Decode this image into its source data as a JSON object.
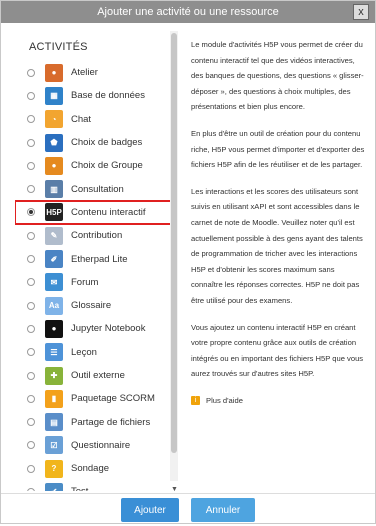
{
  "dialog": {
    "title": "Ajouter une activité ou une ressource",
    "close_label": "x"
  },
  "left": {
    "section_title": "ACTIVITÉS",
    "items": [
      {
        "label": "Atelier",
        "icon": "workshop-icon",
        "color": "#d86b2c",
        "glyph": "●"
      },
      {
        "label": "Base de données",
        "icon": "database-icon",
        "color": "#2f82c9",
        "glyph": "▦"
      },
      {
        "label": "Chat",
        "icon": "chat-icon",
        "color": "#f2a530",
        "glyph": "◔"
      },
      {
        "label": "Choix de badges",
        "icon": "badge-icon",
        "color": "#2b6fbf",
        "glyph": "⬟"
      },
      {
        "label": "Choix de Groupe",
        "icon": "group-choice-icon",
        "color": "#e58a1f",
        "glyph": "●"
      },
      {
        "label": "Consultation",
        "icon": "survey-icon",
        "color": "#5a7ea8",
        "glyph": "▥"
      },
      {
        "label": "Contenu interactif",
        "icon": "h5p-icon",
        "color": "#222222",
        "glyph": "H5P",
        "selected": true
      },
      {
        "label": "Contribution",
        "icon": "assignment-icon",
        "color": "#b0bccc",
        "glyph": "✎"
      },
      {
        "label": "Etherpad Lite",
        "icon": "etherpad-icon",
        "color": "#4a84c4",
        "glyph": "✐"
      },
      {
        "label": "Forum",
        "icon": "forum-icon",
        "color": "#3d8fd3",
        "glyph": "✉"
      },
      {
        "label": "Glossaire",
        "icon": "glossary-icon",
        "color": "#7fb3e8",
        "glyph": "Aa"
      },
      {
        "label": "Jupyter Notebook",
        "icon": "jupyter-icon",
        "color": "#111111",
        "glyph": "●"
      },
      {
        "label": "Leçon",
        "icon": "lesson-icon",
        "color": "#4e93d8",
        "glyph": "☰"
      },
      {
        "label": "Outil externe",
        "icon": "lti-icon",
        "color": "#88b33a",
        "glyph": "✚"
      },
      {
        "label": "Paquetage SCORM",
        "icon": "scorm-icon",
        "color": "#f3a11b",
        "glyph": "▮"
      },
      {
        "label": "Partage de fichiers",
        "icon": "file-share-icon",
        "color": "#5a8ec9",
        "glyph": "▤"
      },
      {
        "label": "Questionnaire",
        "icon": "questionnaire-icon",
        "color": "#6aa0d6",
        "glyph": "☑"
      },
      {
        "label": "Sondage",
        "icon": "poll-icon",
        "color": "#f1b51c",
        "glyph": "?"
      },
      {
        "label": "Test",
        "icon": "quiz-icon",
        "color": "#4b8cc6",
        "glyph": "✔"
      }
    ]
  },
  "right": {
    "paragraphs": [
      "Le module d'activités H5P vous permet de créer du contenu interactif tel que des vidéos interactives, des banques de questions, des questions « glisser-déposer », des questions à choix multiples, des présentations et bien plus encore.",
      "En plus d'être un outil de création pour du contenu riche, H5P vous permet d'importer et d'exporter des fichiers H5P afin de les réutiliser et de les partager.",
      "Les interactions et les scores des utilisateurs sont suivis en utilisant xAPI et sont accessibles dans le carnet de note de Moodle. Veuillez noter qu'il est actuellement possible à des gens ayant des talents de programmation de tricher avec les interactions H5P et d'obtenir les scores maximum sans connaître les réponses correctes. H5P ne doit pas être utilisé pour des examens.",
      "Vous ajoutez un contenu interactif H5P en créant votre propre contenu grâce aux outils de création intégrés ou en important des fichiers H5P que vous aurez trouvés sur d'autres sites H5P."
    ],
    "help_label": "Plus d'aide"
  },
  "footer": {
    "add_label": "Ajouter",
    "cancel_label": "Annuler"
  }
}
